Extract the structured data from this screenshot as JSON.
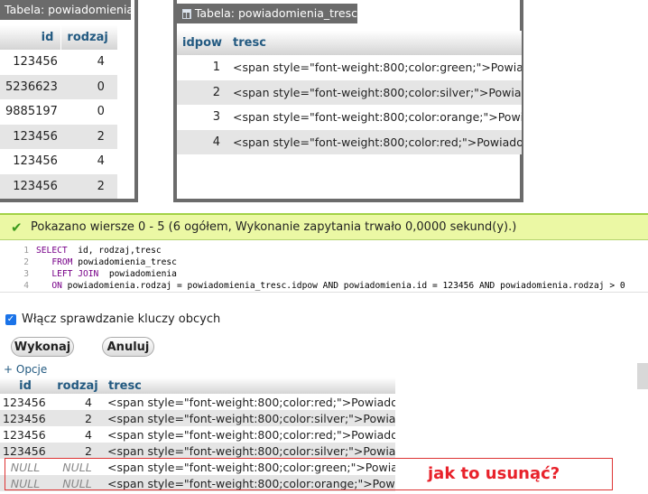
{
  "panel_powiadomienia": {
    "title": "Tabela: powiadomienia",
    "columns": [
      "id",
      "rodzaj"
    ],
    "rows": [
      [
        "123456",
        "4"
      ],
      [
        "5236623",
        "0"
      ],
      [
        "9885197",
        "0"
      ],
      [
        "123456",
        "2"
      ],
      [
        "123456",
        "4"
      ],
      [
        "123456",
        "2"
      ]
    ]
  },
  "panel_powiadomienia_tresc": {
    "title": "Tabela: powiadomienia_tresc",
    "icon": "table-icon",
    "columns": [
      "idpow",
      "tresc"
    ],
    "rows": [
      [
        "1",
        "<span style=\"font-weight:800;color:green;\">Powiadomienie"
      ],
      [
        "2",
        "<span style=\"font-weight:800;color:silver;\">Powiadomienie"
      ],
      [
        "3",
        "<span style=\"font-weight:800;color:orange;\">Powiadomienie"
      ],
      [
        "4",
        "<span style=\"font-weight:800;color:red;\">Powiadomienie"
      ]
    ]
  },
  "status": {
    "icon": "check-icon",
    "message": "Pokazano wiersze 0 - 5 (6 ogółem, Wykonanie zapytania trwało 0,0000 sekund(y).)"
  },
  "sql_lines": [
    {
      "n": "1",
      "kw1": "SELECT",
      "rest": "  id, rodzaj,tresc"
    },
    {
      "n": "2",
      "kw1": "FROM",
      "rest": " powiadomienia_tresc"
    },
    {
      "n": "3",
      "kw1": "LEFT JOIN",
      "rest": "  powiadomienia"
    },
    {
      "n": "4",
      "kw1": "ON",
      "rest": " powiadomienia.rodzaj = powiadomienia_tresc.idpow AND powiadomienia.id = 123456 AND powiadomienia.rodzaj > 0"
    }
  ],
  "fk_check": {
    "label": "Włącz sprawdzanie kluczy obcych",
    "checked": true
  },
  "buttons": {
    "go": "Wykonaj",
    "cancel": "Anuluj"
  },
  "results": {
    "options_label": "+ Opcje",
    "columns": [
      "id",
      "rodzaj",
      "tresc"
    ],
    "rows": [
      [
        "123456",
        "4",
        "<span style=\"font-weight:800;color:red;\">Powiadomienie"
      ],
      [
        "123456",
        "2",
        "<span style=\"font-weight:800;color:silver;\">Powiadomienie"
      ],
      [
        "123456",
        "4",
        "<span style=\"font-weight:800;color:red;\">Powiadomienie"
      ],
      [
        "123456",
        "2",
        "<span style=\"font-weight:800;color:silver;\">Powiadomienie"
      ],
      [
        "NULL",
        "NULL",
        "<span style=\"font-weight:800;color:green;\">Powiadomienie"
      ],
      [
        "NULL",
        "NULL",
        "<span style=\"font-weight:800;color:orange;\">Powiadomienie"
      ]
    ]
  },
  "annotation": "jak to usunąć?",
  "colors": {
    "accent": "#235a81",
    "success_bg": "#ebf8a4",
    "annotation": "#e8222b"
  }
}
